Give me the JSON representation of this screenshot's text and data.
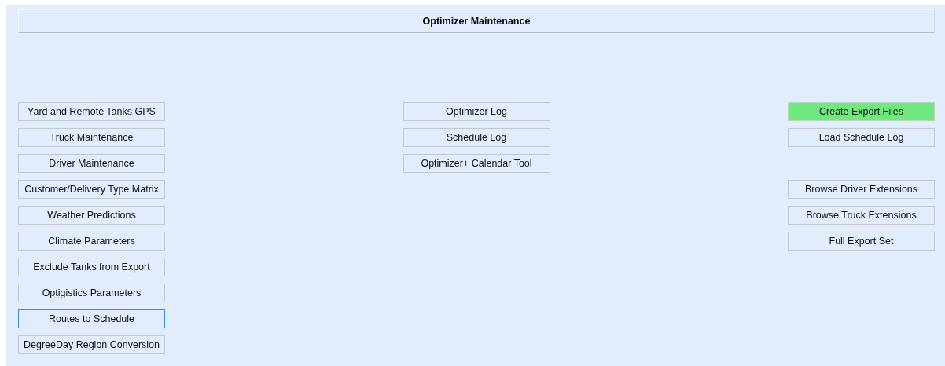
{
  "title": "Optimizer Maintenance",
  "columns": [
    {
      "groups": [
        [
          {
            "label": "Yard and Remote Tanks GPS",
            "highlighted": false,
            "focused": false
          },
          {
            "label": "Truck Maintenance",
            "highlighted": false,
            "focused": false
          },
          {
            "label": "Driver Maintenance",
            "highlighted": false,
            "focused": false
          },
          {
            "label": "Customer/Delivery Type Matrix",
            "highlighted": false,
            "focused": false
          },
          {
            "label": "Weather Predictions",
            "highlighted": false,
            "focused": false
          },
          {
            "label": "Climate Parameters",
            "highlighted": false,
            "focused": false
          },
          {
            "label": "Exclude Tanks from Export",
            "highlighted": false,
            "focused": false
          },
          {
            "label": "Optigistics Parameters",
            "highlighted": false,
            "focused": false
          },
          {
            "label": "Routes to Schedule",
            "highlighted": false,
            "focused": true
          },
          {
            "label": "DegreeDay Region Conversion",
            "highlighted": false,
            "focused": false
          }
        ]
      ]
    },
    {
      "groups": [
        [
          {
            "label": "Optimizer Log",
            "highlighted": false,
            "focused": false
          },
          {
            "label": "Schedule Log",
            "highlighted": false,
            "focused": false
          },
          {
            "label": "Optimizer+ Calendar Tool",
            "highlighted": false,
            "focused": false
          }
        ]
      ]
    },
    {
      "groups": [
        [
          {
            "label": "Create Export Files",
            "highlighted": true,
            "focused": false
          },
          {
            "label": "Load Schedule Log",
            "highlighted": false,
            "focused": false
          }
        ],
        [
          {
            "label": "Browse Driver Extensions",
            "highlighted": false,
            "focused": false
          },
          {
            "label": "Browse Truck Extensions",
            "highlighted": false,
            "focused": false
          },
          {
            "label": "Full Export Set",
            "highlighted": false,
            "focused": false
          }
        ]
      ]
    }
  ]
}
